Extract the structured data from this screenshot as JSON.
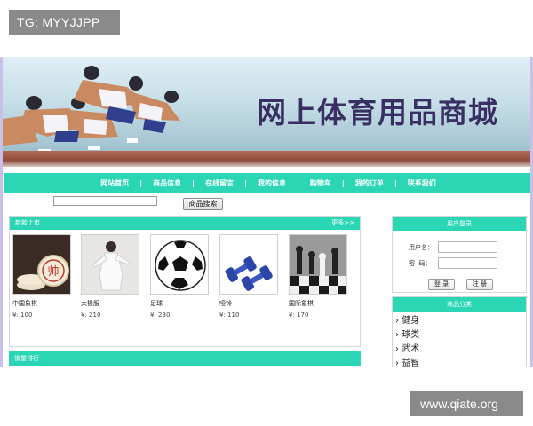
{
  "watermarks": {
    "top_left": "TG: MYYJJPP",
    "bottom_right": "www.qiate.org"
  },
  "banner": {
    "title": "网上体育用品商城"
  },
  "nav": {
    "items": [
      "网站首页",
      "商品信息",
      "在线留言",
      "我的信息",
      "购物车",
      "我的订单",
      "联系我们"
    ],
    "separator": "|"
  },
  "search": {
    "input_value": "",
    "button_label": "商品搜索"
  },
  "new_arrivals": {
    "title": "新款上市",
    "more_label": "更多>>",
    "products": [
      {
        "name": "中国象棋",
        "price": "¥: 100",
        "image_icon": "chinese-chess-icon"
      },
      {
        "name": "太极服",
        "price": "¥: 210",
        "image_icon": "taichi-suit-icon"
      },
      {
        "name": "足球",
        "price": "¥: 230",
        "image_icon": "soccer-ball-icon"
      },
      {
        "name": "哑铃",
        "price": "¥: 110",
        "image_icon": "dumbbell-icon"
      },
      {
        "name": "国际象棋",
        "price": "¥: 170",
        "image_icon": "chess-icon"
      }
    ]
  },
  "sales_rank": {
    "title": "销量排行"
  },
  "login": {
    "title": "用户登录",
    "username_label": "用户名：",
    "password_label": "密  码：",
    "login_button": "登 录",
    "register_button": "注 册"
  },
  "categories": {
    "title": "商品分类",
    "items": [
      "健身",
      "球类",
      "武术",
      "益智"
    ]
  },
  "colors": {
    "accent": "#2ad6b4",
    "banner_title": "#3a2f63",
    "frame_border": "#c9c0ea"
  }
}
